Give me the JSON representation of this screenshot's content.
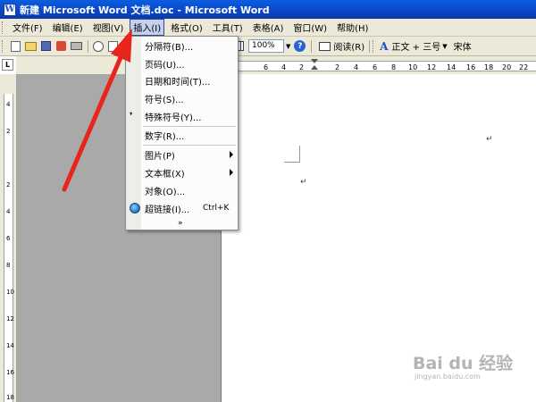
{
  "window": {
    "title": "新建 Microsoft Word 文档.doc - Microsoft Word"
  },
  "menubar": {
    "items": [
      {
        "label": "文件(F)"
      },
      {
        "label": "编辑(E)"
      },
      {
        "label": "视图(V)"
      },
      {
        "label": "插入(I)"
      },
      {
        "label": "格式(O)"
      },
      {
        "label": "工具(T)"
      },
      {
        "label": "表格(A)"
      },
      {
        "label": "窗口(W)"
      },
      {
        "label": "帮助(H)"
      }
    ],
    "active_index": 3
  },
  "toolbar": {
    "zoom_value": "100%",
    "read_label": "阅读(R)",
    "style_value": "正文 + 三号",
    "font_value": "宋体"
  },
  "ruler": {
    "corner_glyph": "L",
    "h_labels": [
      "6",
      "4",
      "2",
      "2",
      "4",
      "6",
      "8",
      "10",
      "12",
      "14",
      "16",
      "18",
      "20",
      "22",
      "24"
    ],
    "v_labels": [
      "4",
      "2",
      "2",
      "4",
      "6",
      "8",
      "10",
      "12",
      "14",
      "16",
      "18"
    ]
  },
  "insert_menu": {
    "items": [
      {
        "label": "分隔符(B)..."
      },
      {
        "label": "页码(U)..."
      },
      {
        "label": "日期和时间(T)..."
      },
      {
        "label": "符号(S)..."
      },
      {
        "label": "特殊符号(Y)..."
      },
      {
        "label": "数字(R)..."
      },
      {
        "label": "图片(P)"
      },
      {
        "label": "文本框(X)"
      },
      {
        "label": "对象(O)..."
      },
      {
        "label": "超链接(I)...",
        "shortcut": "Ctrl+K"
      }
    ],
    "expand_glyph": "»"
  },
  "document": {
    "paragraph_mark": "↵"
  },
  "watermark": {
    "logo": "Bai du 经验",
    "url": "jingyan.baidu.com"
  },
  "annotation": {
    "arrow_color": "#e8241c"
  }
}
